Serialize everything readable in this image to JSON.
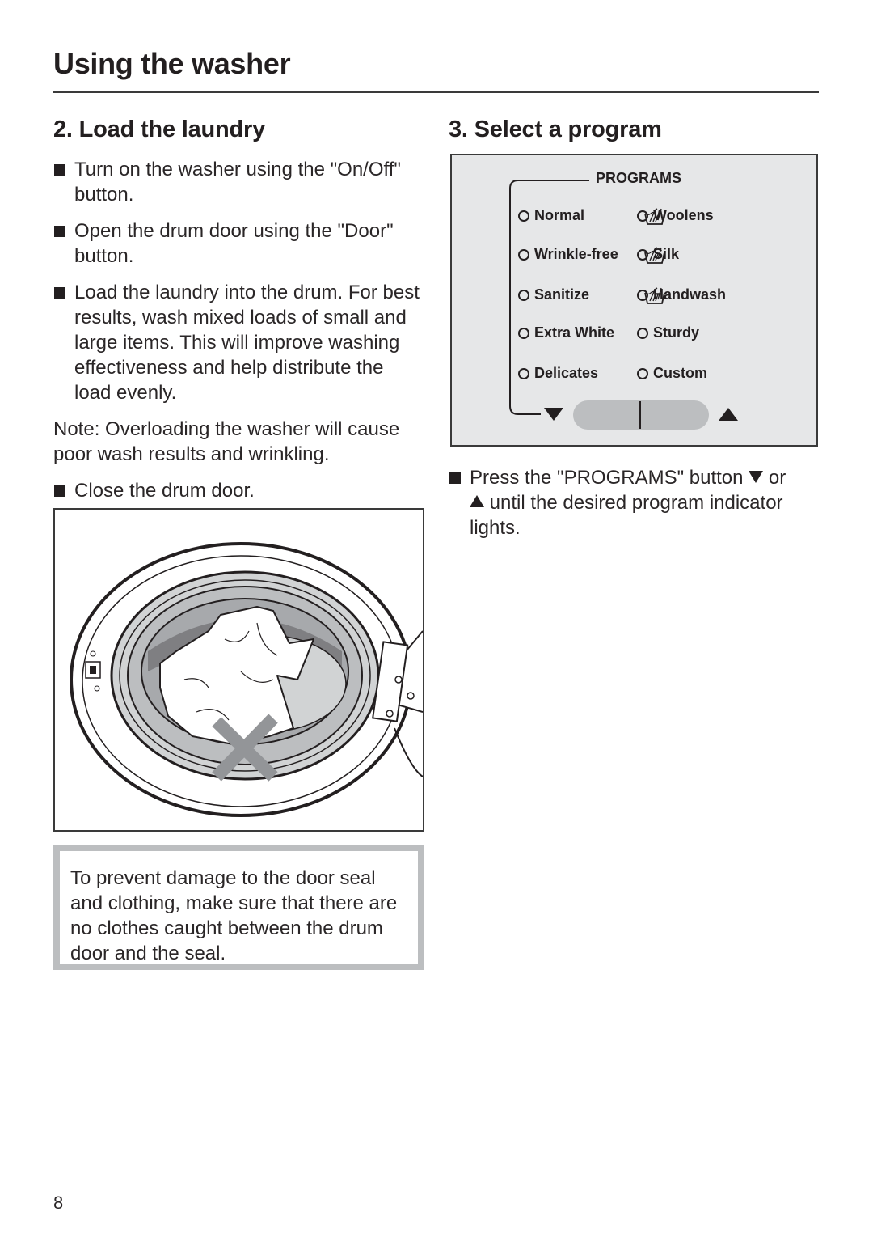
{
  "header": {
    "title": "Using the washer"
  },
  "load_section": {
    "heading": "2. Load the laundry",
    "bullets": [
      "Turn on the washer using the \"On/Off\" button.",
      "Open the drum door using the \"Door\" button.",
      "Load the laundry into the drum. For best results, wash mixed loads of small and large items. This will improve washing effectiveness and help distribute the load evenly."
    ],
    "note": "Note: Overloading the washer will cause poor wash results and wrinkling.",
    "close_bullet": "Close the drum door.",
    "figure": {
      "icon": "washer-drum-illustration",
      "prohibited_mark": "x-mark"
    },
    "warning": "To prevent damage to the door seal and clothing, make sure that there are no clothes caught between the drum door and the seal."
  },
  "program_section": {
    "heading": "3. Select a program",
    "panel": {
      "label": "PROGRAMS",
      "programs_left": [
        {
          "name": "Normal",
          "handwash_icon": false
        },
        {
          "name": "Wrinkle-free",
          "handwash_icon": false
        },
        {
          "name": "Sanitize",
          "handwash_icon": false
        },
        {
          "name": "Extra White",
          "handwash_icon": false
        },
        {
          "name": "Delicates",
          "handwash_icon": false
        }
      ],
      "programs_right": [
        {
          "name": "Woolens",
          "handwash_icon": true
        },
        {
          "name": "Silk",
          "handwash_icon": true
        },
        {
          "name": "Handwash",
          "handwash_icon": true
        },
        {
          "name": "Sturdy",
          "handwash_icon": false
        },
        {
          "name": "Custom",
          "handwash_icon": false
        }
      ],
      "down_arrow": "▼",
      "up_arrow": "▲"
    },
    "instruction_part1": "Press the \"PROGRAMS\" button",
    "instruction_or": "or",
    "instruction_part2": "until the desired program indicator lights."
  },
  "footer": {
    "page_number": "8"
  },
  "colors": {
    "text": "#231f20",
    "panel_bg": "#e6e7e8",
    "rocker": "#bcbec0",
    "warning_border": "#bcbec0"
  }
}
